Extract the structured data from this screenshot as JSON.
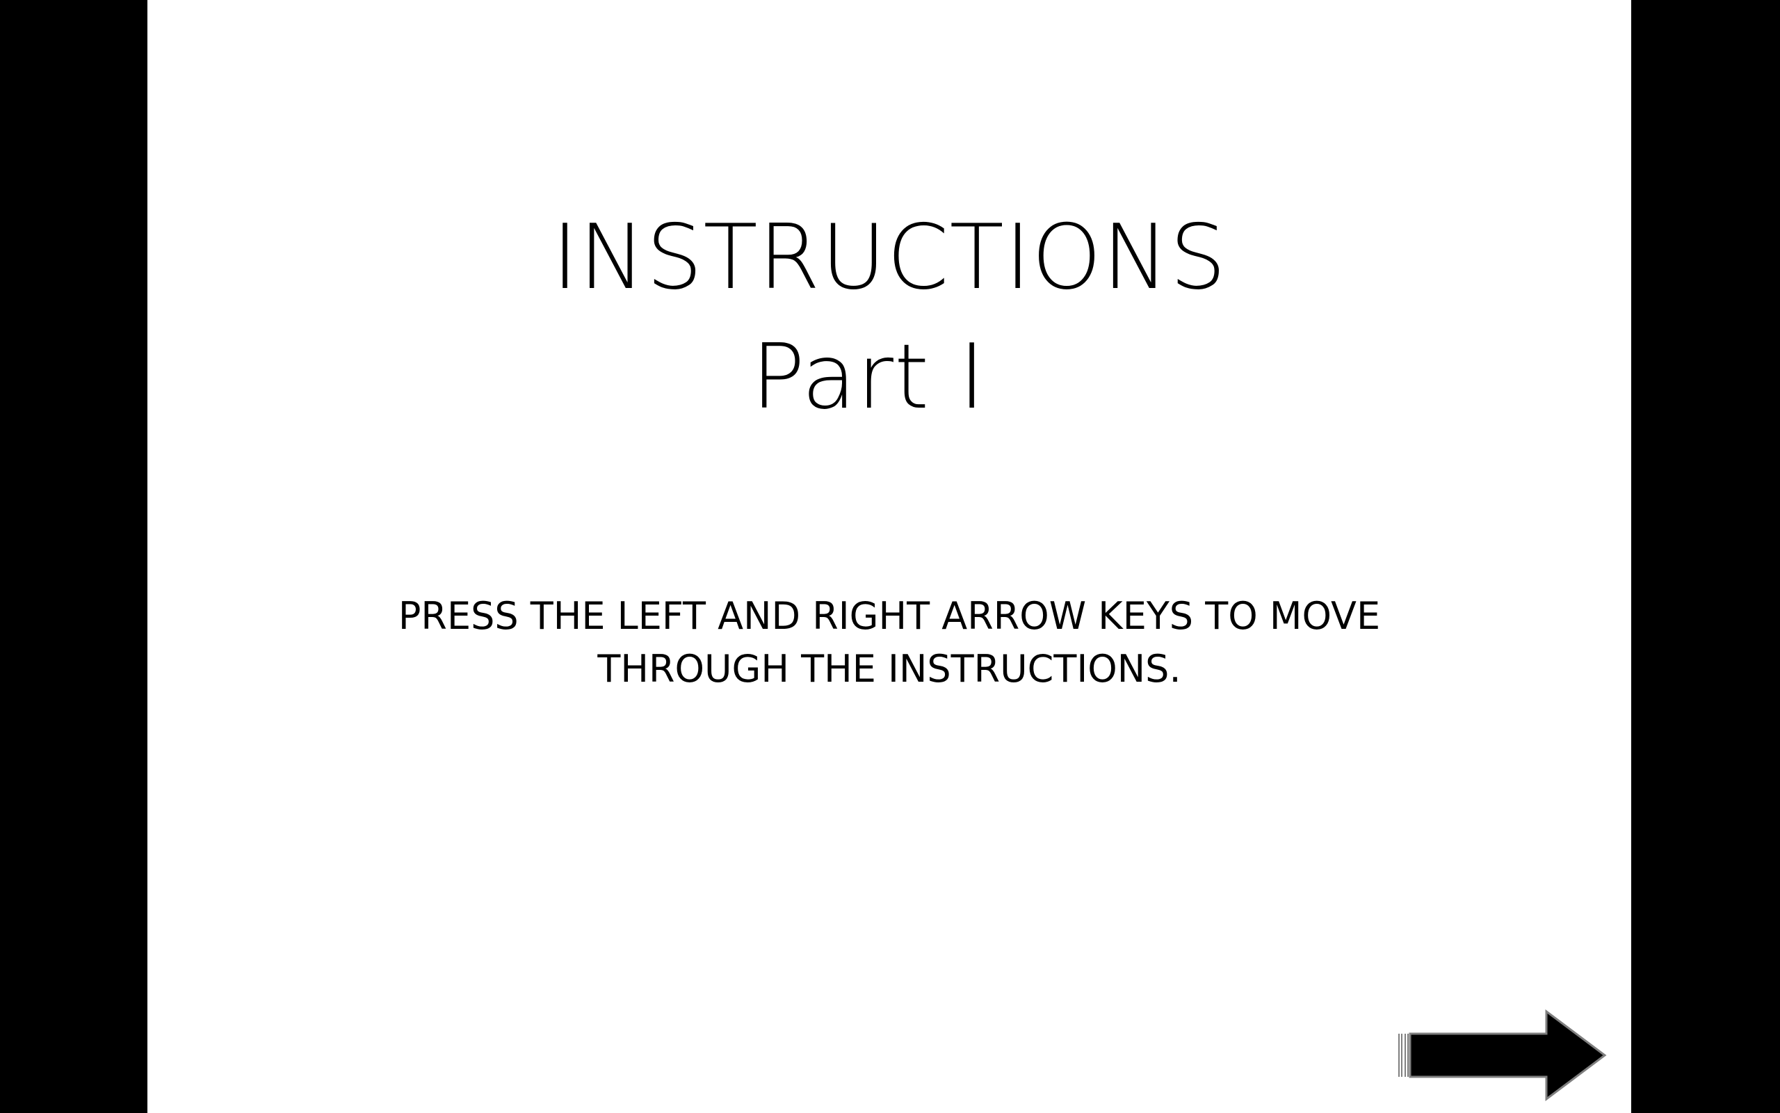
{
  "slide": {
    "title_line1": "INSTRUCTIONS",
    "title_line2": "Part I",
    "instruction_line1": "PRESS THE LEFT AND RIGHT ARROW KEYS TO MOVE",
    "instruction_line2": "THROUGH THE INSTRUCTIONS."
  },
  "navigation": {
    "next_icon": "right-arrow-icon"
  },
  "colors": {
    "background": "#000000",
    "slide": "#ffffff",
    "text": "#000000",
    "arrow_fill": "#000000",
    "arrow_outline": "#7f7f7f"
  }
}
